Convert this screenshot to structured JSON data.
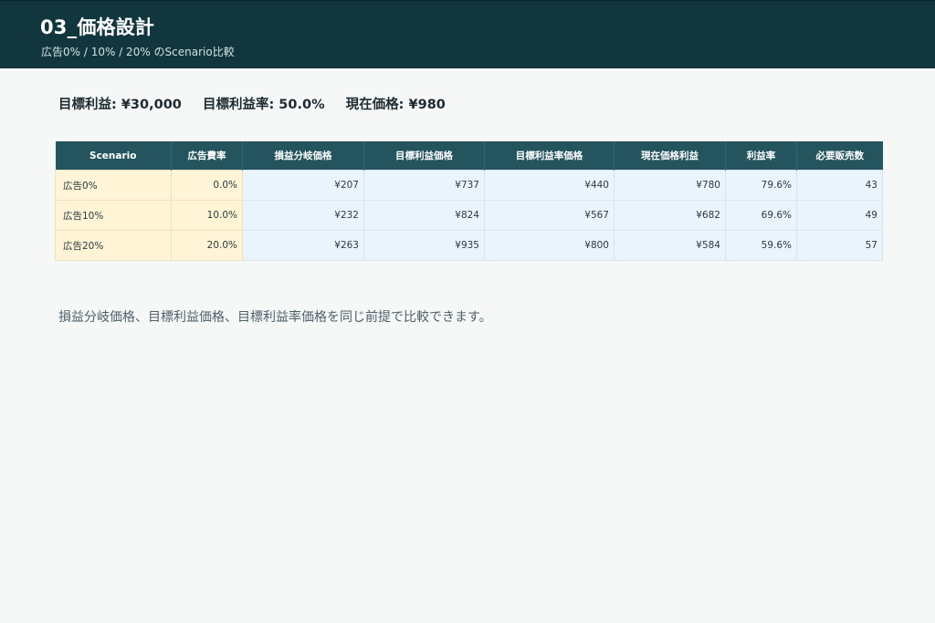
{
  "header": {
    "title": "03_価格設計",
    "subtitle": "広告0% / 10% / 20% のScenario比較"
  },
  "summary": {
    "target_profit": "目標利益: ¥30,000",
    "target_margin": "目標利益率: 50.0%",
    "current_price": "現在価格: ¥980"
  },
  "table": {
    "columns": [
      "Scenario",
      "広告費率",
      "損益分岐価格",
      "目標利益価格",
      "目標利益率価格",
      "現在価格利益",
      "利益率",
      "必要販売数"
    ],
    "rows": [
      [
        "広告0%",
        "0.0%",
        "¥207",
        "¥737",
        "¥440",
        "¥780",
        "79.6%",
        "43"
      ],
      [
        "広告10%",
        "10.0%",
        "¥232",
        "¥824",
        "¥567",
        "¥682",
        "69.6%",
        "49"
      ],
      [
        "広告20%",
        "20.0%",
        "¥263",
        "¥935",
        "¥800",
        "¥584",
        "59.6%",
        "57"
      ]
    ]
  },
  "note": "損益分岐価格、目標利益価格、目標利益率価格を同じ前提で比較できます。"
}
